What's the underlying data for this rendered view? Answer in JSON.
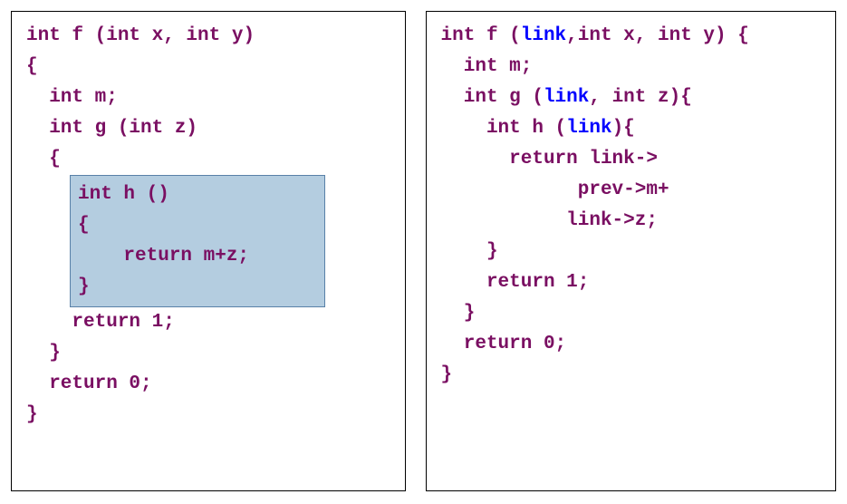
{
  "colors": {
    "code_text": "#7a0f62",
    "link_keyword": "#0000ff",
    "highlight_bg": "#b4cde0",
    "highlight_border": "#5981a8",
    "panel_border": "#000000"
  },
  "keywords": {
    "link": "link"
  },
  "left": {
    "l1": "int f (int x, int y)",
    "l2": "{",
    "l3": "  int m;",
    "l4": "  int g (int z)",
    "l5": "  {",
    "h1": "int h ()",
    "h2": "{",
    "h3": "    return m+z;",
    "h4": "}",
    "l6": "    return 1;",
    "l7": "  }",
    "l8": "  return 0;",
    "l9": "}"
  },
  "right": {
    "r1a": "int f (",
    "r1b": ",int x, int y) {",
    "r2": "  int m;",
    "r3a": "  int g (",
    "r3b": ", int z){",
    "r4a": "    int h (",
    "r4b": "){",
    "r5": "      return link->",
    "r6": "            prev->m+",
    "r7": "           link->z;",
    "r8": "    }",
    "r9": "    return 1;",
    "r10": "  }",
    "r11": "  return 0;",
    "r12": "}"
  }
}
